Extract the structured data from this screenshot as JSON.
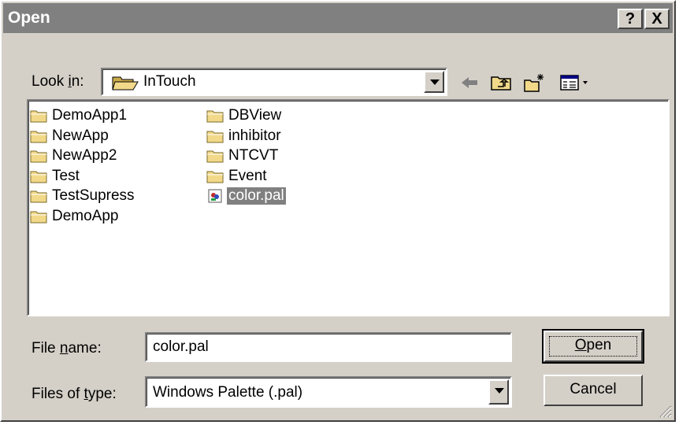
{
  "dialog": {
    "title": "Open",
    "help_button": "?",
    "close_button": "X"
  },
  "look_in": {
    "label_pre": "Look ",
    "label_accel": "i",
    "label_post": "n:",
    "value": "InTouch"
  },
  "files": [
    {
      "name": "DemoApp1",
      "icon": "folder-icon"
    },
    {
      "name": "NewApp",
      "icon": "folder-icon"
    },
    {
      "name": "NewApp2",
      "icon": "folder-icon"
    },
    {
      "name": "Test",
      "icon": "folder-icon"
    },
    {
      "name": "TestSupress",
      "icon": "folder-icon"
    },
    {
      "name": "DemoApp",
      "icon": "folder-icon"
    },
    {
      "name": "DBView",
      "icon": "folder-icon"
    },
    {
      "name": "inhibitor",
      "icon": "folder-icon"
    },
    {
      "name": "NTCVT",
      "icon": "folder-icon"
    },
    {
      "name": "Event",
      "icon": "folder-icon"
    },
    {
      "name": "color.pal",
      "icon": "palette-file-icon",
      "selected": true
    }
  ],
  "file_name": {
    "label_pre": "File ",
    "label_accel": "n",
    "label_post": "ame:",
    "value": "color.pal"
  },
  "file_type": {
    "label_pre": "Files of ",
    "label_accel": "t",
    "label_post": "ype:",
    "value": "Windows Palette (.pal)"
  },
  "buttons": {
    "open_accel": "O",
    "open_rest": "pen",
    "cancel": "Cancel"
  },
  "colors": {
    "face": "#d4d0c8",
    "title_inactive": "#808080",
    "selection": "#808080",
    "folder": "#f2d98a"
  }
}
